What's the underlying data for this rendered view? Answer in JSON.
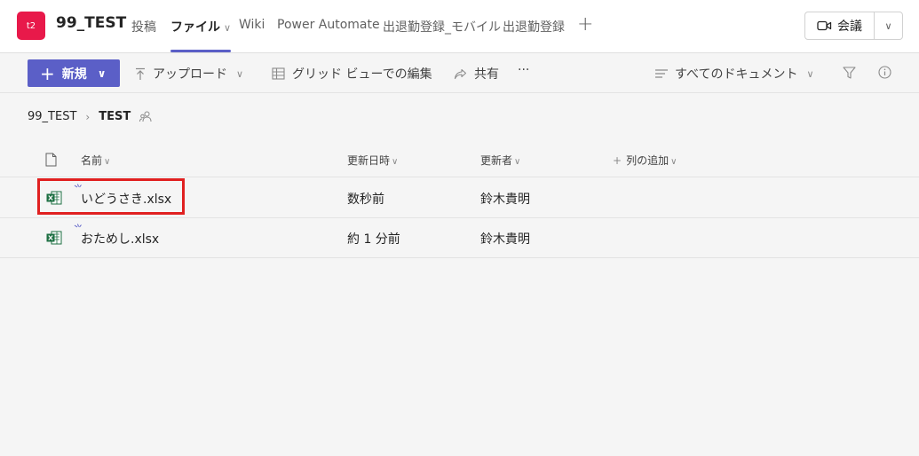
{
  "header": {
    "team_avatar": "t2",
    "team_name": "99_TEST",
    "tabs": [
      {
        "label": "投稿"
      },
      {
        "label": "ファイル"
      },
      {
        "label": "Wiki"
      },
      {
        "label": "Power Automate"
      },
      {
        "label": "出退勤登録_モバイル"
      },
      {
        "label": "出退勤登録"
      }
    ],
    "active_tab": "ファイル",
    "add_tab_icon": "plus-icon",
    "meet_label": "会議"
  },
  "toolbar": {
    "new_label": "新規",
    "upload_label": "アップロード",
    "grid_edit_label": "グリッド ビューでの編集",
    "share_label": "共有",
    "more_label": "···",
    "view_label": "すべてのドキュメント"
  },
  "breadcrumb": {
    "parent": "99_TEST",
    "current": "TEST"
  },
  "table": {
    "columns": {
      "name": "名前",
      "modified": "更新日時",
      "modified_by": "更新者",
      "add_column": "列の追加"
    },
    "rows": [
      {
        "name": "いどうさき.xlsx",
        "modified": "数秒前",
        "modified_by": "鈴木貴明"
      },
      {
        "name": "おためし.xlsx",
        "modified": "約 1 分前",
        "modified_by": "鈴木貴明"
      }
    ]
  },
  "colors": {
    "accent": "#5b5fc7",
    "team_avatar": "#e8194a",
    "highlight": "#e02020",
    "excel": "#1d6f42"
  }
}
